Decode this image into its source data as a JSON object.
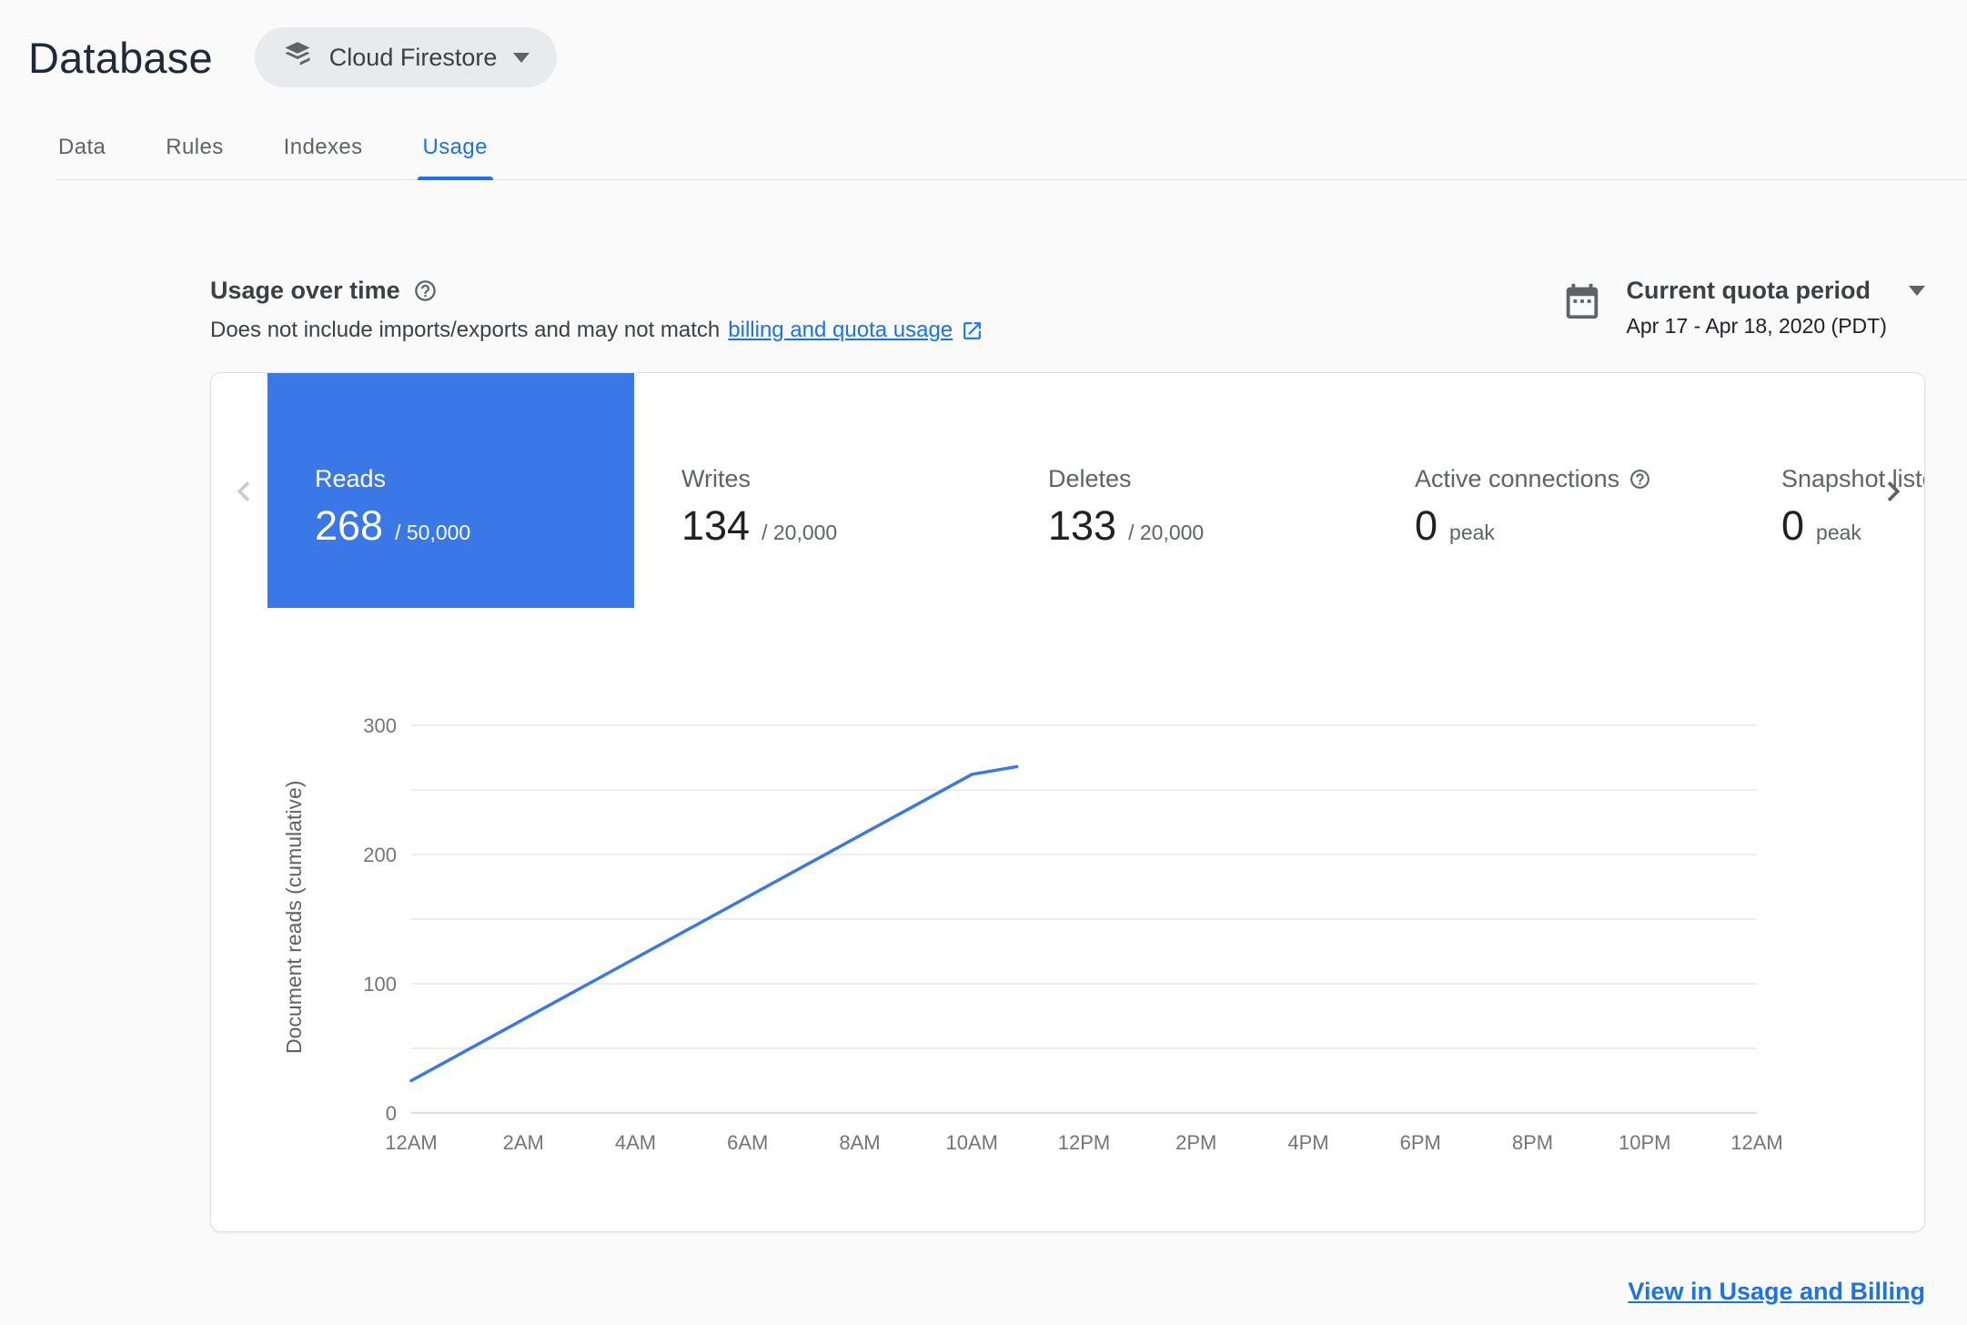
{
  "colors": {
    "accent_blue": "#1a73e8",
    "selected_metric_bg": "#3b78e7",
    "chart_line": "#3b78e7"
  },
  "page": {
    "title": "Database",
    "product_selector": {
      "label": "Cloud Firestore"
    },
    "tabs": [
      {
        "label": "Data",
        "active": false
      },
      {
        "label": "Rules",
        "active": false
      },
      {
        "label": "Indexes",
        "active": false
      },
      {
        "label": "Usage",
        "active": true
      }
    ]
  },
  "usage_header": {
    "title": "Usage over time",
    "description_prefix": "Does not include imports/exports and may not match",
    "description_link": "billing and quota usage",
    "period_selector": {
      "label": "Current quota period",
      "range": "Apr 17 - Apr 18, 2020 (PDT)"
    }
  },
  "metrics": [
    {
      "label": "Reads",
      "value": "268",
      "suffix": "/ 50,000",
      "selected": true,
      "has_help": false
    },
    {
      "label": "Writes",
      "value": "134",
      "suffix": "/ 20,000",
      "selected": false,
      "has_help": false
    },
    {
      "label": "Deletes",
      "value": "133",
      "suffix": "/ 20,000",
      "selected": false,
      "has_help": false
    },
    {
      "label": "Active connections",
      "value": "0",
      "suffix": "peak",
      "selected": false,
      "has_help": true
    },
    {
      "label": "Snapshot listeners",
      "value": "0",
      "suffix": "peak",
      "selected": false,
      "has_help": false
    }
  ],
  "footer": {
    "link_label": "View in Usage and Billing"
  },
  "chart_data": {
    "type": "line",
    "title": "Usage over time — Reads (cumulative)",
    "xlabel": "",
    "ylabel": "Document reads (cumulative)",
    "x_ticks": [
      "12AM",
      "2AM",
      "4AM",
      "6AM",
      "8AM",
      "10AM",
      "12PM",
      "2PM",
      "4PM",
      "6PM",
      "8PM",
      "10PM",
      "12AM"
    ],
    "y_ticks": [
      0,
      100,
      200,
      300
    ],
    "ylim": [
      0,
      300
    ],
    "xlim_hours": [
      0,
      24
    ],
    "gridline_step": 50,
    "grid": true,
    "legend": false,
    "series": [
      {
        "name": "Document reads (cumulative)",
        "color": "#3b78e7",
        "points": [
          {
            "hour": 0,
            "value": 25
          },
          {
            "hour": 10,
            "value": 262
          },
          {
            "hour": 10.8,
            "value": 268
          }
        ]
      }
    ]
  }
}
